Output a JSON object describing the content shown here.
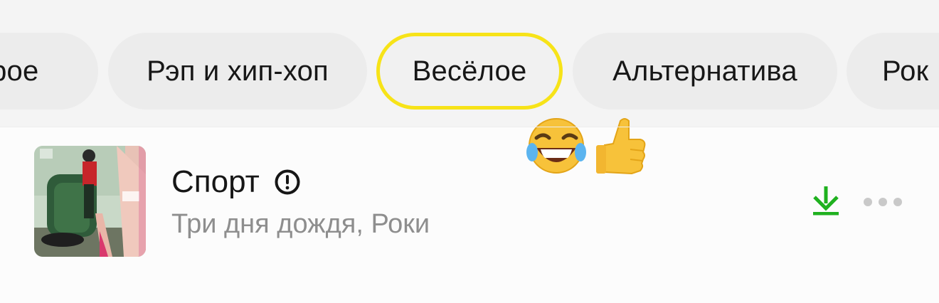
{
  "genre_chips": [
    {
      "label": "дрое",
      "selected": false
    },
    {
      "label": "Рэп и хип-хоп",
      "selected": false
    },
    {
      "label": "Весёлое",
      "selected": true
    },
    {
      "label": "Альтернатива",
      "selected": false
    },
    {
      "label": "Рок",
      "selected": false
    }
  ],
  "track": {
    "title": "Спорт",
    "artist": "Три дня дождя, Роки",
    "explicit_icon": "exclamation-circle-icon",
    "cover_icon": "album-cover"
  },
  "reaction_emojis": "😂👍",
  "actions": {
    "download_icon": "download-icon",
    "more_icon": "more-dots-icon"
  },
  "colors": {
    "selected_border": "#f7e318",
    "chip_bg": "#ececec",
    "download_green": "#1fb11f",
    "muted_text": "#8e8e8e"
  }
}
